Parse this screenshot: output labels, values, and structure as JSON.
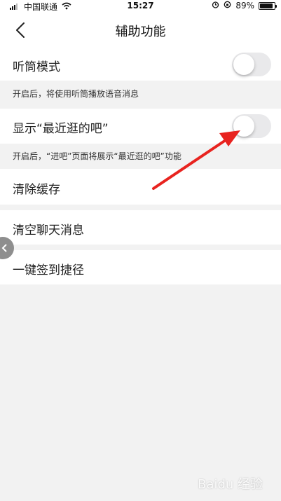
{
  "status_bar": {
    "carrier": "中国联通",
    "time": "15:27",
    "battery_percent": "89%",
    "battery_level": 0.89
  },
  "navbar": {
    "title": "辅助功能",
    "back_icon": "chevron-left-icon"
  },
  "settings": {
    "receiver_mode": {
      "label": "听筒模式",
      "enabled": false,
      "note": "开启后，将使用听筒播放语音消息"
    },
    "show_recent": {
      "label": "显示“最近逛的吧”",
      "enabled": false,
      "note": "开启后，“进吧”页面将展示“最近逛的吧”功能"
    },
    "clear_cache": {
      "label": "清除缓存"
    },
    "clear_chat": {
      "label": "清空聊天消息"
    },
    "sign_in_shortcut": {
      "label": "一键签到捷径"
    }
  },
  "annotation": {
    "arrow_color": "#e8231f"
  },
  "watermark": {
    "text": "Baidu 经验"
  }
}
